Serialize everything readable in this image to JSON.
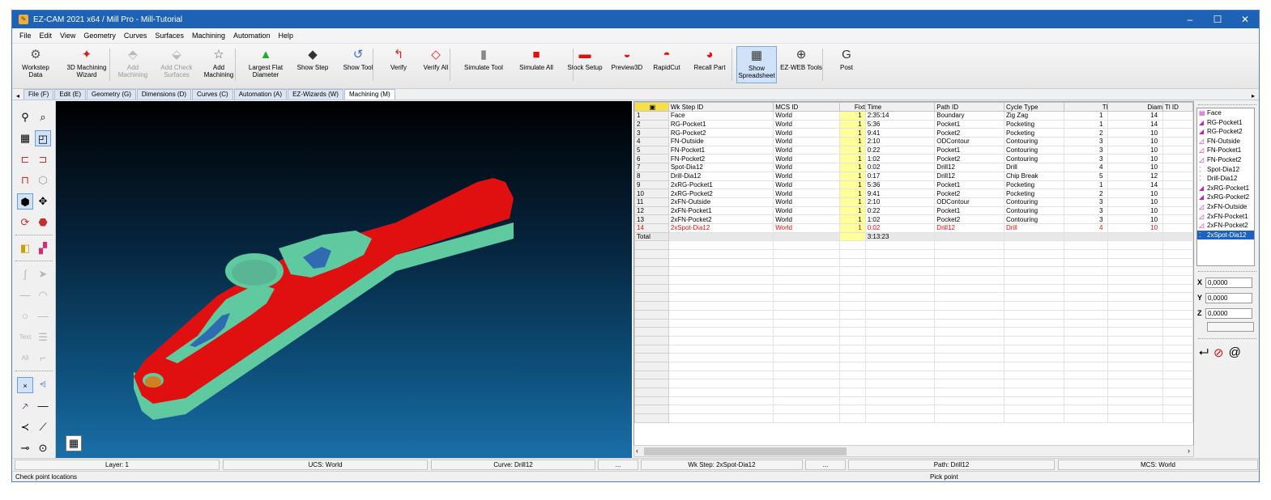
{
  "window": {
    "title": "EZ-CAM 2021 x64 / Mill Pro  - Mill-Tutorial",
    "minimize": "–",
    "maximize": "☐",
    "close": "✕"
  },
  "menu": [
    "File",
    "Edit",
    "View",
    "Geometry",
    "Curves",
    "Surfaces",
    "Machining",
    "Automation",
    "Help"
  ],
  "toolbar": [
    {
      "label": "Workstep\nData",
      "icon": "workstep-icon",
      "glyph": "⚙",
      "color": "#555555",
      "disabled": false
    },
    {
      "label": "3D Machining\nWizard",
      "icon": "wizard-icon",
      "glyph": "✦",
      "color": "#cc2222",
      "disabled": false
    },
    {
      "label": "Add\nMachining",
      "icon": "add-machining-icon",
      "glyph": "⬘",
      "color": "#999999",
      "disabled": true
    },
    {
      "label": "Add Check\nSurfaces",
      "icon": "check-surfaces-icon",
      "glyph": "⬙",
      "color": "#999999",
      "disabled": true
    },
    {
      "label": "Add\nMachining",
      "icon": "add-machining-star-icon",
      "glyph": "☆",
      "color": "#555555",
      "disabled": false
    },
    {
      "label": "Largest Flat\nDiameter",
      "icon": "flat-diameter-icon",
      "glyph": "▲",
      "color": "#22aa33",
      "disabled": false
    },
    {
      "label": "Show Step",
      "icon": "show-step-icon",
      "glyph": "◆",
      "color": "#333333",
      "disabled": false
    },
    {
      "label": "Show Tool",
      "icon": "show-tool-icon",
      "glyph": "↺",
      "color": "#3a6fd0",
      "disabled": false
    },
    {
      "label": "Verify",
      "icon": "verify-icon",
      "glyph": "↰",
      "color": "#dd2222",
      "disabled": false
    },
    {
      "label": "Verify All",
      "icon": "verify-all-icon",
      "glyph": "◇",
      "color": "#dd2222",
      "disabled": false
    },
    {
      "label": "Simulate Tool",
      "icon": "simulate-tool-icon",
      "glyph": "▮",
      "color": "#888888",
      "disabled": false
    },
    {
      "label": "Simulate All",
      "icon": "simulate-all-icon",
      "glyph": "■",
      "color": "#dd1111",
      "disabled": false
    },
    {
      "label": "Stock Setup",
      "icon": "stock-setup-icon",
      "glyph": "▬",
      "color": "#dd1111",
      "disabled": false
    },
    {
      "label": "Preview3D",
      "icon": "preview3d-icon",
      "glyph": "◒",
      "color": "#cc2222",
      "disabled": false
    },
    {
      "label": "RapidCut",
      "icon": "rapidcut-icon",
      "glyph": "◓",
      "color": "#dd1111",
      "disabled": false
    },
    {
      "label": "Recall Part",
      "icon": "recall-part-icon",
      "glyph": "◕",
      "color": "#dd1111",
      "disabled": false
    },
    {
      "label": "Show\nSpreadsheet",
      "icon": "spreadsheet-icon",
      "glyph": "▦",
      "color": "#333333",
      "disabled": false,
      "active": true
    },
    {
      "label": "EZ-WEB Tools",
      "icon": "web-tools-icon",
      "glyph": "⊕",
      "color": "#333333",
      "disabled": false
    },
    {
      "label": "Post",
      "icon": "post-icon",
      "glyph": "G",
      "color": "#333333",
      "disabled": false
    }
  ],
  "tabs": [
    "File (F)",
    "Edit (E)",
    "Geometry (G)",
    "Dimensions (D)",
    "Curves (C)",
    "Automation (A)",
    "EZ-Wizards (W)",
    "Machining (M)"
  ],
  "selected_tab": "Machining (M)",
  "left_tools": {
    "text_label": "Text",
    "all_label": "All"
  },
  "spreadsheet": {
    "corner": "▣",
    "columns": [
      "",
      "Wk Step ID",
      "MCS ID",
      "Fixt",
      "Time",
      "Path ID",
      "Cycle Type",
      "Tl",
      "Diam",
      "Tl ID"
    ],
    "rows": [
      [
        "1",
        "Face",
        "World",
        "1",
        "2:35:14",
        "Boundary",
        "Zig Zag",
        "1",
        "14",
        ""
      ],
      [
        "2",
        "RG-Pocket1",
        "World",
        "1",
        "5:36",
        "Pocket1",
        "Pocketing",
        "1",
        "14",
        ""
      ],
      [
        "3",
        "RG-Pocket2",
        "World",
        "1",
        "9:41",
        "Pocket2",
        "Pocketing",
        "2",
        "10",
        ""
      ],
      [
        "4",
        "FN-Outside",
        "World",
        "1",
        "2:10",
        "ODContour",
        "Contouring",
        "3",
        "10",
        ""
      ],
      [
        "5",
        "FN-Pocket1",
        "World",
        "1",
        "0:22",
        "Pocket1",
        "Contouring",
        "3",
        "10",
        ""
      ],
      [
        "6",
        "FN-Pocket2",
        "World",
        "1",
        "1:02",
        "Pocket2",
        "Contouring",
        "3",
        "10",
        ""
      ],
      [
        "7",
        "Spot-Dia12",
        "World",
        "1",
        "0:02",
        "Drill12",
        "Drill",
        "4",
        "10",
        ""
      ],
      [
        "8",
        "Drill-Dia12",
        "World",
        "1",
        "0:17",
        "Drill12",
        "Chip Break",
        "5",
        "12",
        ""
      ],
      [
        "9",
        "2xRG-Pocket1",
        "World",
        "1",
        "5:36",
        "Pocket1",
        "Pocketing",
        "1",
        "14",
        ""
      ],
      [
        "10",
        "2xRG-Pocket2",
        "World",
        "1",
        "9:41",
        "Pocket2",
        "Pocketing",
        "2",
        "10",
        ""
      ],
      [
        "11",
        "2xFN-Outside",
        "World",
        "1",
        "2:10",
        "ODContour",
        "Contouring",
        "3",
        "10",
        ""
      ],
      [
        "12",
        "2xFN-Pocket1",
        "World",
        "1",
        "0:22",
        "Pocket1",
        "Contouring",
        "3",
        "10",
        ""
      ],
      [
        "13",
        "2xFN-Pocket2",
        "World",
        "1",
        "1:02",
        "Pocket2",
        "Contouring",
        "3",
        "10",
        ""
      ],
      [
        "14",
        "2xSpot-Dia12",
        "World",
        "1",
        "0:02",
        "Drill12",
        "Drill",
        "4",
        "10",
        ""
      ]
    ],
    "highlight_row": 14,
    "total": {
      "label": "Total",
      "time": "3:13:23"
    }
  },
  "step_list": [
    {
      "label": "Face",
      "icon": "face-icon",
      "glyph": "▤"
    },
    {
      "label": "RG-Pocket1",
      "icon": "rough-pocket-icon",
      "glyph": "◢"
    },
    {
      "label": "RG-Pocket2",
      "icon": "rough-pocket-icon",
      "glyph": "◢"
    },
    {
      "label": "FN-Outside",
      "icon": "finish-icon",
      "glyph": "◿"
    },
    {
      "label": "FN-Pocket1",
      "icon": "finish-icon",
      "glyph": "◿"
    },
    {
      "label": "FN-Pocket2",
      "icon": "finish-icon",
      "glyph": "◿"
    },
    {
      "label": "Spot-Dia12",
      "icon": "spot-icon",
      "glyph": "⁚"
    },
    {
      "label": "Drill-Dia12",
      "icon": "drill-icon",
      "glyph": "⁚"
    },
    {
      "label": "2xRG-Pocket1",
      "icon": "rough-pocket-icon",
      "glyph": "◢"
    },
    {
      "label": "2xRG-Pocket2",
      "icon": "rough-pocket-icon",
      "glyph": "◢"
    },
    {
      "label": "2xFN-Outside",
      "icon": "finish-icon",
      "glyph": "◿"
    },
    {
      "label": "2xFN-Pocket1",
      "icon": "finish-icon",
      "glyph": "◿"
    },
    {
      "label": "2xFN-Pocket2",
      "icon": "finish-icon",
      "glyph": "◿"
    },
    {
      "label": "2xSpot-Dia12",
      "icon": "spot-icon",
      "glyph": "⁚"
    }
  ],
  "selected_step": "2xSpot-Dia12",
  "coords": {
    "x_label": "X",
    "y_label": "Y",
    "z_label": "Z",
    "x": "0,0000",
    "y": "0,0000",
    "z": "0,0000"
  },
  "right_icons": {
    "enter": "⮠",
    "cancel": "⊘",
    "at": "@"
  },
  "status": {
    "layer": "Layer: 1",
    "ucs": "UCS: World",
    "curve": "Curve: Drill12",
    "dots1": "...",
    "wkstep": "Wk Step: 2xSpot-Dia12",
    "dots2": "...",
    "path": "Path: Drill12",
    "mcs": "MCS: World"
  },
  "info": {
    "left": "Check point locations",
    "right": "Pick point"
  },
  "colors": {
    "part_top": "#e01010",
    "part_side": "#5fc9a0",
    "pocket_floor": "#2f6bb0",
    "hole": "#d08020",
    "title_bar": "#1e62b5",
    "fixture": "#ffff99"
  }
}
